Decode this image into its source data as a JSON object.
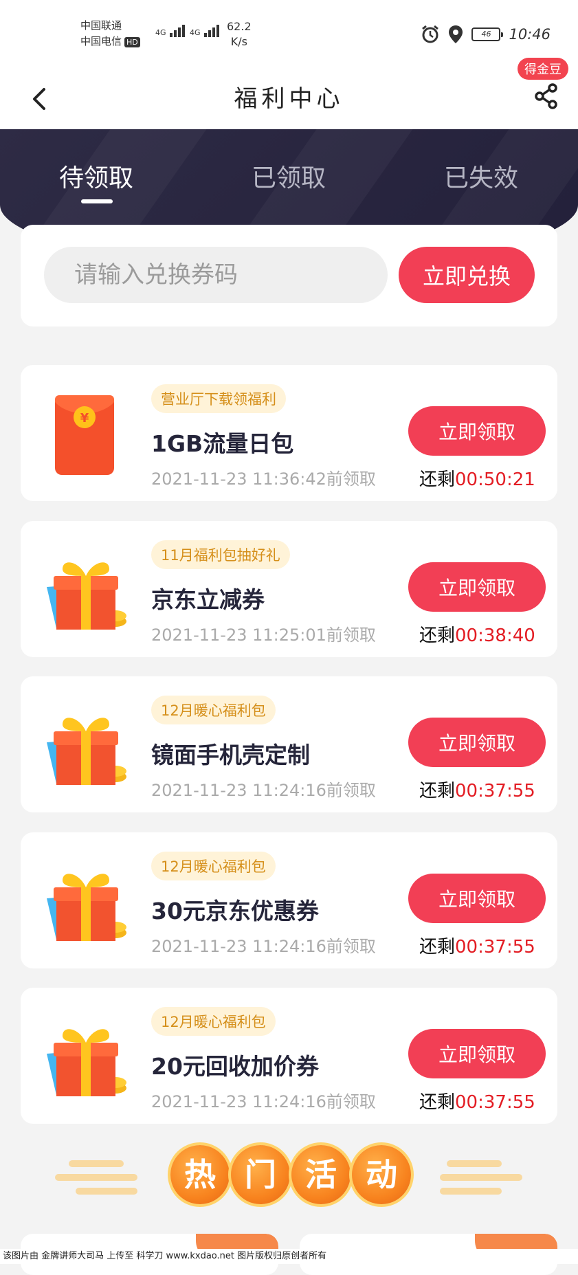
{
  "status_bar": {
    "carrier_1": "中国联通",
    "carrier_2": "中国电信",
    "hd": "HD",
    "net_1": "4G",
    "net_2": "4G",
    "speed_value": "62.2",
    "speed_unit": "K/s",
    "battery": "46",
    "time": "10:46"
  },
  "nav": {
    "title": "福利中心",
    "coin_badge": "得金豆"
  },
  "tabs": [
    {
      "label": "待领取",
      "active": true
    },
    {
      "label": "已领取",
      "active": false
    },
    {
      "label": "已失效",
      "active": false
    }
  ],
  "redeem": {
    "placeholder": "请输入兑换券码",
    "button": "立即兑换"
  },
  "coupons": [
    {
      "icon": "red-envelope-icon",
      "tag": "营业厅下载领福利",
      "name": "1GB流量日包",
      "deadline": "2021-11-23 11:36:42前领取",
      "button": "立即领取",
      "remain_label": "还剩",
      "countdown": "00:50:21"
    },
    {
      "icon": "gift-box-icon",
      "tag": "11月福利包抽好礼",
      "name": "京东立减券",
      "deadline": "2021-11-23 11:25:01前领取",
      "button": "立即领取",
      "remain_label": "还剩",
      "countdown": "00:38:40"
    },
    {
      "icon": "gift-box-icon",
      "tag": "12月暖心福利包",
      "name": "镜面手机壳定制",
      "deadline": "2021-11-23 11:24:16前领取",
      "button": "立即领取",
      "remain_label": "还剩",
      "countdown": "00:37:55"
    },
    {
      "icon": "gift-box-icon",
      "tag": "12月暖心福利包",
      "name": "30元京东优惠券",
      "deadline": "2021-11-23 11:24:16前领取",
      "button": "立即领取",
      "remain_label": "还剩",
      "countdown": "00:37:55"
    },
    {
      "icon": "gift-box-icon",
      "tag": "12月暖心福利包",
      "name": "20元回收加价券",
      "deadline": "2021-11-23 11:24:16前领取",
      "button": "立即领取",
      "remain_label": "还剩",
      "countdown": "00:37:55"
    }
  ],
  "hot": {
    "chars": [
      "热",
      "门",
      "活",
      "动"
    ]
  },
  "footer_note": "该图片由 金牌讲师大司马 上传至 科学刀 www.kxdao.net 图片版权归原创者所有",
  "colors": {
    "accent": "#f23f55",
    "hero_bg": "#2e2b45",
    "countdown": "#e31d24",
    "tag_bg": "#fff3d8",
    "tag_text": "#d58f1a"
  }
}
